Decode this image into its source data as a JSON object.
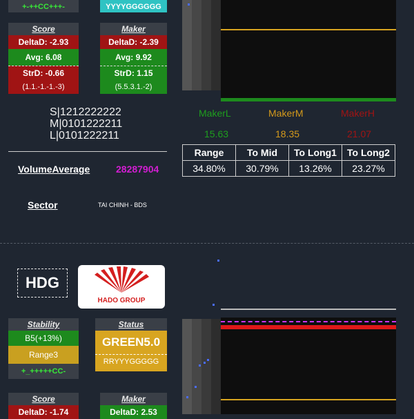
{
  "top": {
    "trend_strip": "+-++CC+++-",
    "rry_strip": "YYYYGGGGGG"
  },
  "score_card": {
    "title": "Score",
    "delta": "DeltaD: -2.93",
    "avg": "Avg: 6.08",
    "str": "StrD: -0.66",
    "seq": "(1.1.-1.-1.-3)"
  },
  "maker_card": {
    "title": "Maker",
    "delta": "DeltaD: -2.39",
    "avg": "Avg: 9.92",
    "str": "StrD: 1.15",
    "seq": "(5.5.3.1.-2)"
  },
  "slm": {
    "s": "S|1212222222",
    "m": "M|0101222211",
    "l": "L|0101222211"
  },
  "makers": {
    "l_label": "MakerL",
    "m_label": "MakerM",
    "h_label": "MakerH",
    "l_value": "15.63",
    "m_value": "18.35",
    "h_value": "21.07"
  },
  "stats_table": {
    "headers": [
      "Range",
      "To Mid",
      "To Long1",
      "To Long2"
    ],
    "values": [
      "34.80%",
      "30.79%",
      "13.26%",
      "23.27%"
    ]
  },
  "volume": {
    "label": "VolumeAverage",
    "value": "28287904"
  },
  "sector": {
    "label": "Sector",
    "value": "TAI CHINH - BDS"
  },
  "stock2": {
    "ticker": "HDG",
    "logo_text": "HADO GROUP",
    "stability": {
      "title": "Stability",
      "b": "B5(+13%)",
      "range": "Range3",
      "trend": "+_+++++CC-"
    },
    "status": {
      "title": "Status",
      "value": "GREEN5.0",
      "rry": "RRYYYGGGGG"
    },
    "score": {
      "title": "Score",
      "delta": "DeltaD: -1.74"
    },
    "maker": {
      "title": "Maker",
      "delta": "DeltaD: 2.53"
    }
  },
  "colors": {
    "page_bg": "#1f2631",
    "red": "#a01414",
    "green": "#1d8a1d",
    "gold": "#d8a520",
    "maker_l": "#1e9e1e",
    "maker_m": "#d49a1c",
    "maker_h": "#a01414",
    "volume_value": "#d21ed2"
  }
}
